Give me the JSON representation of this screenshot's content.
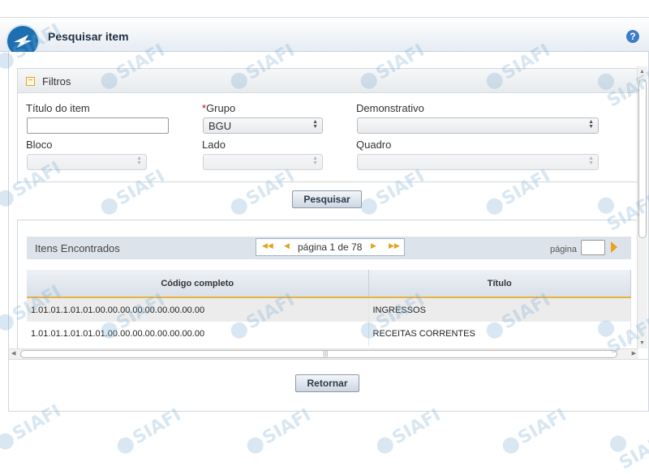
{
  "header": {
    "title": "Pesquisar item",
    "help_icon": "?"
  },
  "filters": {
    "title": "Filtros",
    "titulo_label": "Título do item",
    "titulo_value": "",
    "grupo_required": "*",
    "grupo_label": "Grupo",
    "grupo_value": "BGU",
    "demonstrativo_label": "Demonstrativo",
    "demonstrativo_value": "",
    "bloco_label": "Bloco",
    "bloco_value": "",
    "lado_label": "Lado",
    "lado_value": "",
    "quadro_label": "Quadro",
    "quadro_value": "",
    "search_button": "Pesquisar"
  },
  "results": {
    "title": "Itens Encontrados",
    "pager_text": "página 1 de 78",
    "page_label": "página",
    "page_value": "",
    "columns": [
      "Código completo",
      "Título"
    ],
    "rows": [
      [
        "1.01.01.1.01.01.00.00.00.00.00.00.00.00.00",
        "INGRESSOS"
      ],
      [
        "1.01.01.1.01.01.01.00.00.00.00.00.00.00.00",
        "RECEITAS CORRENTES"
      ]
    ]
  },
  "footer": {
    "back_button": "Retornar"
  },
  "watermark": "SIAFI",
  "colors": {
    "accent": "#e7a21e",
    "brand": "#1d6fb1"
  }
}
